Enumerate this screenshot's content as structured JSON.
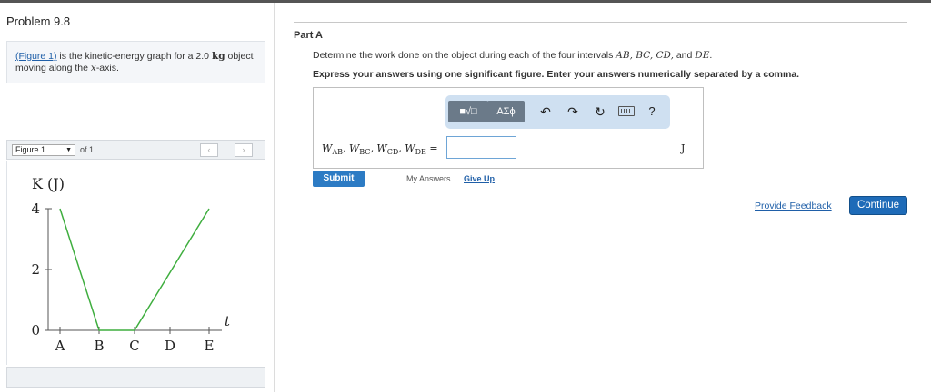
{
  "problem": {
    "title": "Problem 9.8",
    "intro": {
      "figure_link": "(Figure 1)",
      "text_1": " is the kinetic-energy graph for a 2.0 ",
      "mass_unit": "kg",
      "text_2": " object moving along the ",
      "axis_var": "x",
      "text_3": "-axis."
    }
  },
  "figure_nav": {
    "selected": "Figure 1",
    "of_label": "of 1",
    "prev_icon": "chevron-left-icon",
    "next_icon": "chevron-right-icon"
  },
  "chart_data": {
    "type": "line",
    "ylabel": "K (J)",
    "xlabel": "t",
    "y_ticks": [
      "4",
      "2",
      "0"
    ],
    "ylim": [
      0,
      4
    ],
    "x_ticks": [
      "A",
      "B",
      "C",
      "D",
      "E"
    ],
    "series": [
      {
        "x": [
          "A",
          "B",
          "C",
          "E"
        ],
        "values": [
          4,
          0,
          0,
          4
        ]
      }
    ],
    "line_color": "#3fae3f"
  },
  "part": {
    "title": "Part A",
    "question_1": "Determine the work done on the object during each of the four intervals ",
    "question_vars": "AB, BC, CD,",
    "question_2": " and ",
    "question_last": "DE",
    "question_end": ".",
    "instruction": "Express your answers using one significant figure. Enter your answers numerically separated by a comma."
  },
  "toolbar": {
    "template_label": "■√□",
    "greek_label": "ΑΣϕ",
    "undo_icon": "undo-icon",
    "redo_icon": "redo-icon",
    "reset_icon": "reset-icon",
    "keyboard_icon": "keyboard-icon",
    "help_label": "?"
  },
  "answer": {
    "w_ab": "AB",
    "w_bc": "BC",
    "w_cd": "CD",
    "w_de": "DE",
    "value": "",
    "unit": "J"
  },
  "actions": {
    "submit_label": "Submit",
    "my_answers_label": "My Answers",
    "give_up_label": "Give Up",
    "feedback_label": "Provide Feedback",
    "continue_label": "Continue"
  }
}
